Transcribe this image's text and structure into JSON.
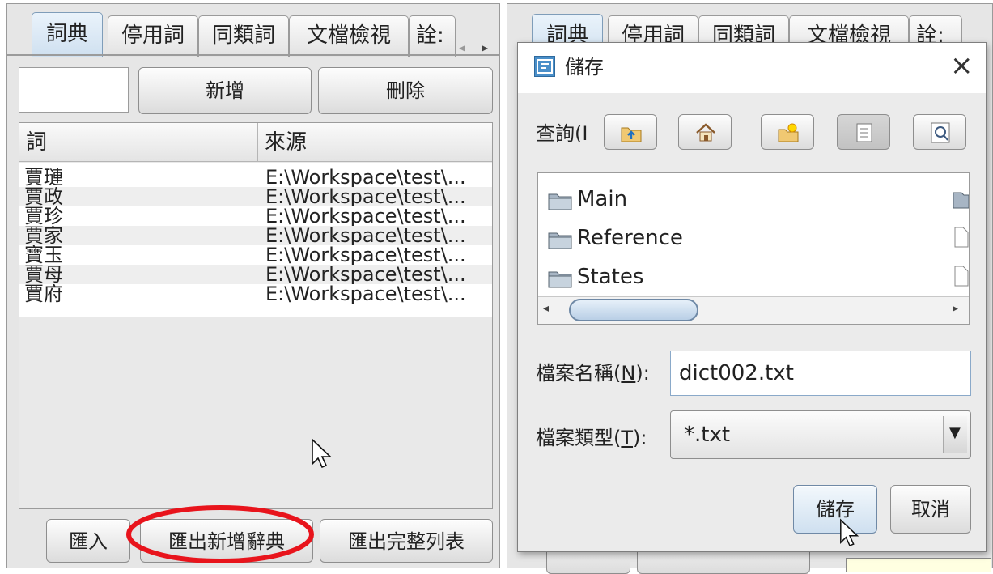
{
  "left_panel": {
    "tabs": [
      {
        "label": "詞典",
        "selected": true
      },
      {
        "label": "停用詞",
        "selected": false
      },
      {
        "label": "同類詞",
        "selected": false
      },
      {
        "label": "文檔檢視",
        "selected": false
      },
      {
        "label": "詮:",
        "selected": false
      }
    ],
    "scroll_left": "◂",
    "scroll_right": "▸",
    "word_input_value": "",
    "add_button": "新增",
    "delete_button": "刪除",
    "table": {
      "headers": [
        "詞",
        "來源"
      ],
      "rows": [
        {
          "word": "賈璉",
          "source": "E:\\Workspace\\test\\..."
        },
        {
          "word": "賈政",
          "source": "E:\\Workspace\\test\\..."
        },
        {
          "word": "賈珍",
          "source": "E:\\Workspace\\test\\..."
        },
        {
          "word": "賈家",
          "source": "E:\\Workspace\\test\\..."
        },
        {
          "word": "寶玉",
          "source": "E:\\Workspace\\test\\..."
        },
        {
          "word": "賈母",
          "source": "E:\\Workspace\\test\\..."
        },
        {
          "word": "賈府",
          "source": "E:\\Workspace\\test\\..."
        }
      ]
    },
    "import_button": "匯入",
    "export_new_button": "匯出新增辭典",
    "export_full_button": "匯出完整列表"
  },
  "right_window": {
    "tabs": [
      "詞典",
      "停用詞",
      "同類詞",
      "文檔檢視",
      "詮:"
    ]
  },
  "save_dialog": {
    "title": "儲存",
    "close": "×",
    "look_in_label": "查詢(I",
    "files": [
      {
        "name": "Main",
        "type": "folder"
      },
      {
        "name": "Reference",
        "type": "folder"
      },
      {
        "name": "States",
        "type": "folder"
      }
    ],
    "filename_label_prefix": "檔案名稱(",
    "filename_label_mnemonic": "N",
    "filename_label_suffix": "):",
    "filename_value": "dict002.txt",
    "filetype_label_prefix": "檔案類型(",
    "filetype_label_mnemonic": "T",
    "filetype_label_suffix": "):",
    "filetype_value": "*.txt",
    "save_button": "儲存",
    "cancel_button": "取消"
  },
  "colors": {
    "highlight_ellipse": "#e8141c",
    "selected_tab": "#cfe0f0",
    "panel_bg": "#e6e6e6"
  }
}
